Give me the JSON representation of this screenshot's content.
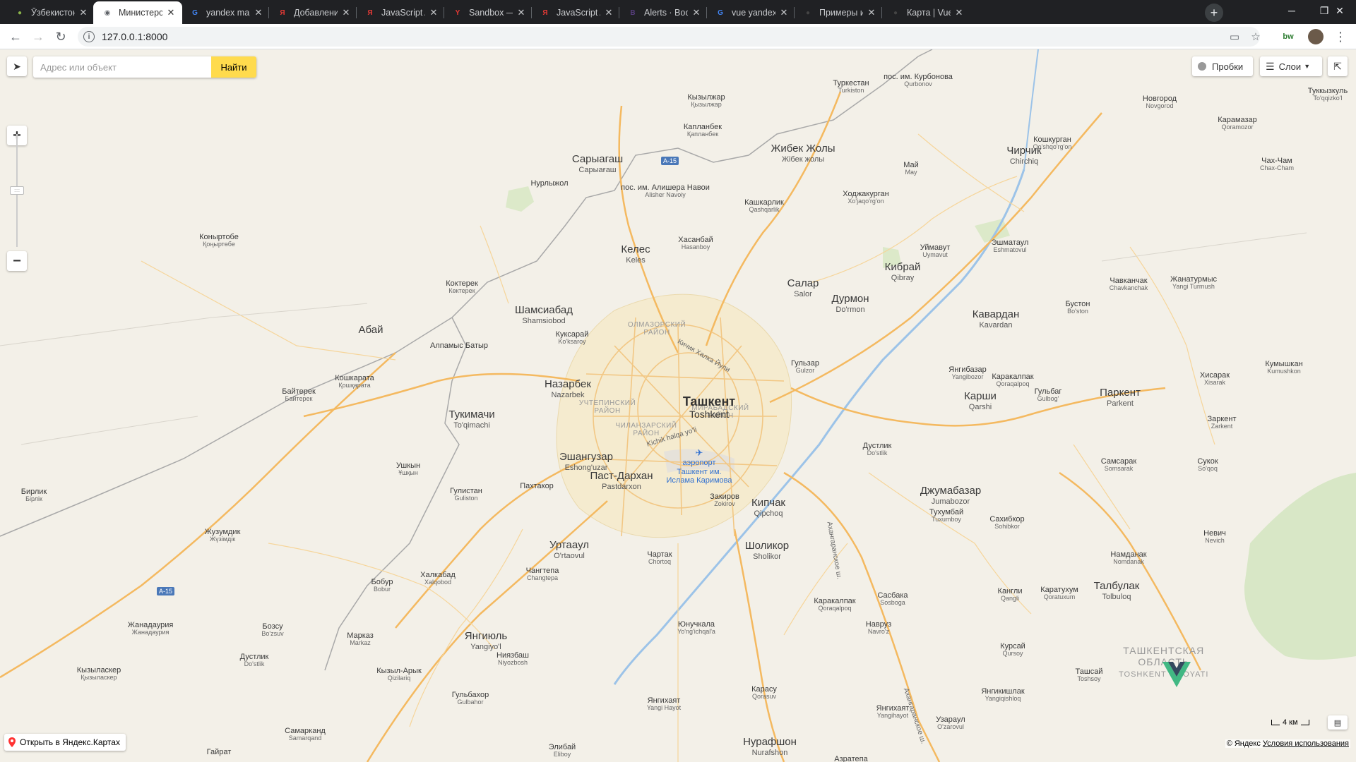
{
  "browser": {
    "tabs": [
      {
        "title": "Ўзбекистон Республ",
        "icon": "site-icon",
        "fav": "●",
        "fav_color": "#8ab34a",
        "active": false
      },
      {
        "title": "Министерство за",
        "icon": "globe-icon",
        "fav": "◉",
        "fav_color": "#5f6368",
        "active": true
      },
      {
        "title": "yandex map glyph",
        "icon": "google-icon",
        "fav": "G",
        "fav_color": "#4285f4",
        "active": false
      },
      {
        "title": "Добавление мет",
        "icon": "yandex-icon",
        "fav": "Я",
        "fav_color": "#e53935",
        "active": false
      },
      {
        "title": "JavaScript API —",
        "icon": "yandex-icon",
        "fav": "Я",
        "fav_color": "#e53935",
        "active": false
      },
      {
        "title": "Sandbox — Yand",
        "icon": "yandex-icon",
        "fav": "Y",
        "fav_color": "#e53935",
        "active": false
      },
      {
        "title": "JavaScript API —",
        "icon": "yandex-icon",
        "fav": "Я",
        "fav_color": "#e53935",
        "active": false
      },
      {
        "title": "Alerts · Bootstrap",
        "icon": "bootstrap-icon",
        "fav": "B",
        "fav_color": "#563d7c",
        "active": false
      },
      {
        "title": "vue yandex map",
        "icon": "google-icon",
        "fav": "G",
        "fav_color": "#4285f4",
        "active": false
      },
      {
        "title": "Примеры испол",
        "icon": "github-icon",
        "fav": "●",
        "fav_color": "#444",
        "active": false
      },
      {
        "title": "Карта | Vue-yand",
        "icon": "github-icon",
        "fav": "●",
        "fav_color": "#444",
        "active": false
      }
    ],
    "new_tab": "+",
    "url": "127.0.0.1:8000",
    "minimize": "─",
    "maximize": "❐",
    "close": "✕",
    "avatar_text": "bw"
  },
  "map": {
    "search": {
      "placeholder": "Адрес или объект",
      "button": "Найти"
    },
    "traffic_label": "Пробки",
    "layers_label": "Слои",
    "open_in_yandex": "Открыть в Яндекс.Картах",
    "copyright": "© Яндекс",
    "terms": "Условия использования",
    "scale_label": "4 км",
    "region_label": [
      "ТАШКЕНТСКАЯ",
      "ОБЛАСТЬ",
      "TOSHKENT VILOYATI"
    ],
    "airport": [
      "аэропорт",
      "Ташкент им.",
      "Ислама Каримова"
    ],
    "road_names": [
      "Kichik halqa yo'li",
      "Кичик Халка Йули",
      "Ахангаранское ш.",
      "Ахангаранское ш."
    ],
    "shields": [
      "A-15",
      "A-15"
    ],
    "districts": [
      [
        "ОЛМАЗОРСКИЙ",
        "РАЙОН"
      ],
      [
        "УЧТЕПИНСКИЙ",
        "РАЙОН"
      ],
      [
        "ЧИЛАНЗАРСКИЙ",
        "РАЙОН"
      ],
      [
        "МИРАБАДСКИЙ",
        "РАЙОН"
      ]
    ],
    "places": [
      {
        "n": "Ташкент",
        "t": "Toshkent"
      },
      {
        "n": "Туркестан",
        "t": "Turkiston"
      },
      {
        "n": "пос. им. Курбонова",
        "t": "Qurbonov"
      },
      {
        "n": "Туккызкуль",
        "t": "To'qqizko'l"
      },
      {
        "n": "Кызылжар",
        "t": "Қызылжар"
      },
      {
        "n": "Новгород",
        "t": "Novgorod"
      },
      {
        "n": "Карамазар",
        "t": "Qoramozor"
      },
      {
        "n": "Капланбек",
        "t": "Қапланбек"
      },
      {
        "n": "Жибек Жолы",
        "t": "Жібек жолы"
      },
      {
        "n": "Чирчик",
        "t": "Chirchiq"
      },
      {
        "n": "Кошкурган",
        "t": "Qo'shqo'rg'on"
      },
      {
        "n": "Сарыагаш",
        "t": "Сарыағаш"
      },
      {
        "n": "Май",
        "t": "May"
      },
      {
        "n": "Чах-Чам",
        "t": "Chax-Cham"
      },
      {
        "n": "Нурлыжол",
        "t": ""
      },
      {
        "n": "пос. им. Алишера Навои",
        "t": "Alisher Navoiy"
      },
      {
        "n": "Кашкарлик",
        "t": "Qashqarlik"
      },
      {
        "n": "Ходжакурган",
        "t": "Xo'jaqo'rg'on"
      },
      {
        "n": "Коныртобе",
        "t": "Қоңыртөбе"
      },
      {
        "n": "Хасанбай",
        "t": "Hasanboy"
      },
      {
        "n": "Келес",
        "t": "Keles"
      },
      {
        "n": "Уймавут",
        "t": "Uymavut"
      },
      {
        "n": "Эшматаул",
        "t": "Eshmatovul"
      },
      {
        "n": "Кибрай",
        "t": "Qibray"
      },
      {
        "n": "Чавканчак",
        "t": "Chavkanchak"
      },
      {
        "n": "Жанатурмыс",
        "t": "Yangi Turmush"
      },
      {
        "n": "Коктерек",
        "t": "Көктерек"
      },
      {
        "n": "Салар",
        "t": "Salor"
      },
      {
        "n": "Дурмон",
        "t": "Do'rmon"
      },
      {
        "n": "Бустон",
        "t": "Bo'ston"
      },
      {
        "n": "Шамсиабад",
        "t": "Shamsiobod"
      },
      {
        "n": "Кавардан",
        "t": "Kavardan"
      },
      {
        "n": "Абай",
        "t": ""
      },
      {
        "n": "Куксарай",
        "t": "Ko'ksaroy"
      },
      {
        "n": "Алпамыс Батыр",
        "t": ""
      },
      {
        "n": "Гульзар",
        "t": "Gulzor"
      },
      {
        "n": "Кумышкан",
        "t": "Kumushkon"
      },
      {
        "n": "Янгибазар",
        "t": "Yangibozor"
      },
      {
        "n": "Кошкарата",
        "t": "Қошқарата"
      },
      {
        "n": "Назарбек",
        "t": "Nazarbek"
      },
      {
        "n": "Каракалпак",
        "t": "Qoraqalpoq"
      },
      {
        "n": "Хисарак",
        "t": "Xisarak"
      },
      {
        "n": "Байтерек",
        "t": "Байтерек"
      },
      {
        "n": "Карши",
        "t": "Qarshi"
      },
      {
        "n": "Гульбаг",
        "t": "Gulbog'"
      },
      {
        "n": "Паркент",
        "t": "Parkent"
      },
      {
        "n": "Тукимачи",
        "t": "To'qimachi"
      },
      {
        "n": "Заркент",
        "t": "Zarkent"
      },
      {
        "n": "Дустлик",
        "t": "Do'stlik"
      },
      {
        "n": "Эшангузар",
        "t": "Eshong'uzar"
      },
      {
        "n": "Ушкын",
        "t": "Ұшқын"
      },
      {
        "n": "Сукок",
        "t": "So'qoq"
      },
      {
        "n": "Самсарак",
        "t": "Somsarak"
      },
      {
        "n": "Пахтакор",
        "t": ""
      },
      {
        "n": "Паст-Дархан",
        "t": "Pastdarxon"
      },
      {
        "n": "Джумабазар",
        "t": "Jumabozor"
      },
      {
        "n": "Гулистан",
        "t": "Guliston"
      },
      {
        "n": "Бирлик",
        "t": "Бірлік"
      },
      {
        "n": "Закиров",
        "t": "Zokirov"
      },
      {
        "n": "Кипчак",
        "t": "Qipchoq"
      },
      {
        "n": "Тухумбай",
        "t": "Tuxumboy"
      },
      {
        "n": "Сахибкор",
        "t": "Sohibkor"
      },
      {
        "n": "Невич",
        "t": "Nevich"
      },
      {
        "n": "Жузумдик",
        "t": "Жүзімдік"
      },
      {
        "n": "Уртааул",
        "t": "O'rtaovul"
      },
      {
        "n": "Шоликор",
        "t": "Sholikor"
      },
      {
        "n": "Намданак",
        "t": "Nomdanak"
      },
      {
        "n": "Чартак",
        "t": "Chortoq"
      },
      {
        "n": "Чангтепа",
        "t": "Changtepa"
      },
      {
        "n": "Халкабад",
        "t": "Xalqobod"
      },
      {
        "n": "Бобур",
        "t": "Bobur"
      },
      {
        "n": "Талбулак",
        "t": "Tolbuloq"
      },
      {
        "n": "Кангли",
        "t": "Qangli"
      },
      {
        "n": "Каратухум",
        "t": "Qoratuxum"
      },
      {
        "n": "Сасбака",
        "t": "Sosboga"
      },
      {
        "n": "Каракалпак",
        "t": "Qoraqalpoq"
      },
      {
        "n": "Жанадаурия",
        "t": "Жанадаурия"
      },
      {
        "n": "Бозсу",
        "t": "Bo'zsuv"
      },
      {
        "n": "Юнучкала",
        "t": "Yo'ng'ichqal'a"
      },
      {
        "n": "Навруз",
        "t": "Navro'z"
      },
      {
        "n": "Янгиюль",
        "t": "Yangiyo'l"
      },
      {
        "n": "Марказ",
        "t": "Markaz"
      },
      {
        "n": "Курсай",
        "t": "Qursoy"
      },
      {
        "n": "Ниязбаш",
        "t": "Niyozbosh"
      },
      {
        "n": "Дустлик",
        "t": "Do'stlik"
      },
      {
        "n": "Кызыласкер",
        "t": "Қызыласкер"
      },
      {
        "n": "Кызыл-Арык",
        "t": "Qizilariq"
      },
      {
        "n": "Ташсай",
        "t": "Toshsoy"
      },
      {
        "n": "Гульбахор",
        "t": "Gulbahor"
      },
      {
        "n": "Карасу",
        "t": "Qorasuv"
      },
      {
        "n": "Янгикишлак",
        "t": "Yangiqishloq"
      },
      {
        "n": "Янгихаят",
        "t": "Yangi Hayot"
      },
      {
        "n": "Янгихаят",
        "t": "Yangihayot"
      },
      {
        "n": "Узарaул",
        "t": "O'zarovul"
      },
      {
        "n": "Самарканд",
        "t": "Samarqand"
      },
      {
        "n": "Гайрат",
        "t": ""
      },
      {
        "n": "Элибай",
        "t": "Eliboy"
      },
      {
        "n": "Нурафшон",
        "t": "Nurafshon"
      },
      {
        "n": "Азратепа",
        "t": ""
      }
    ]
  }
}
